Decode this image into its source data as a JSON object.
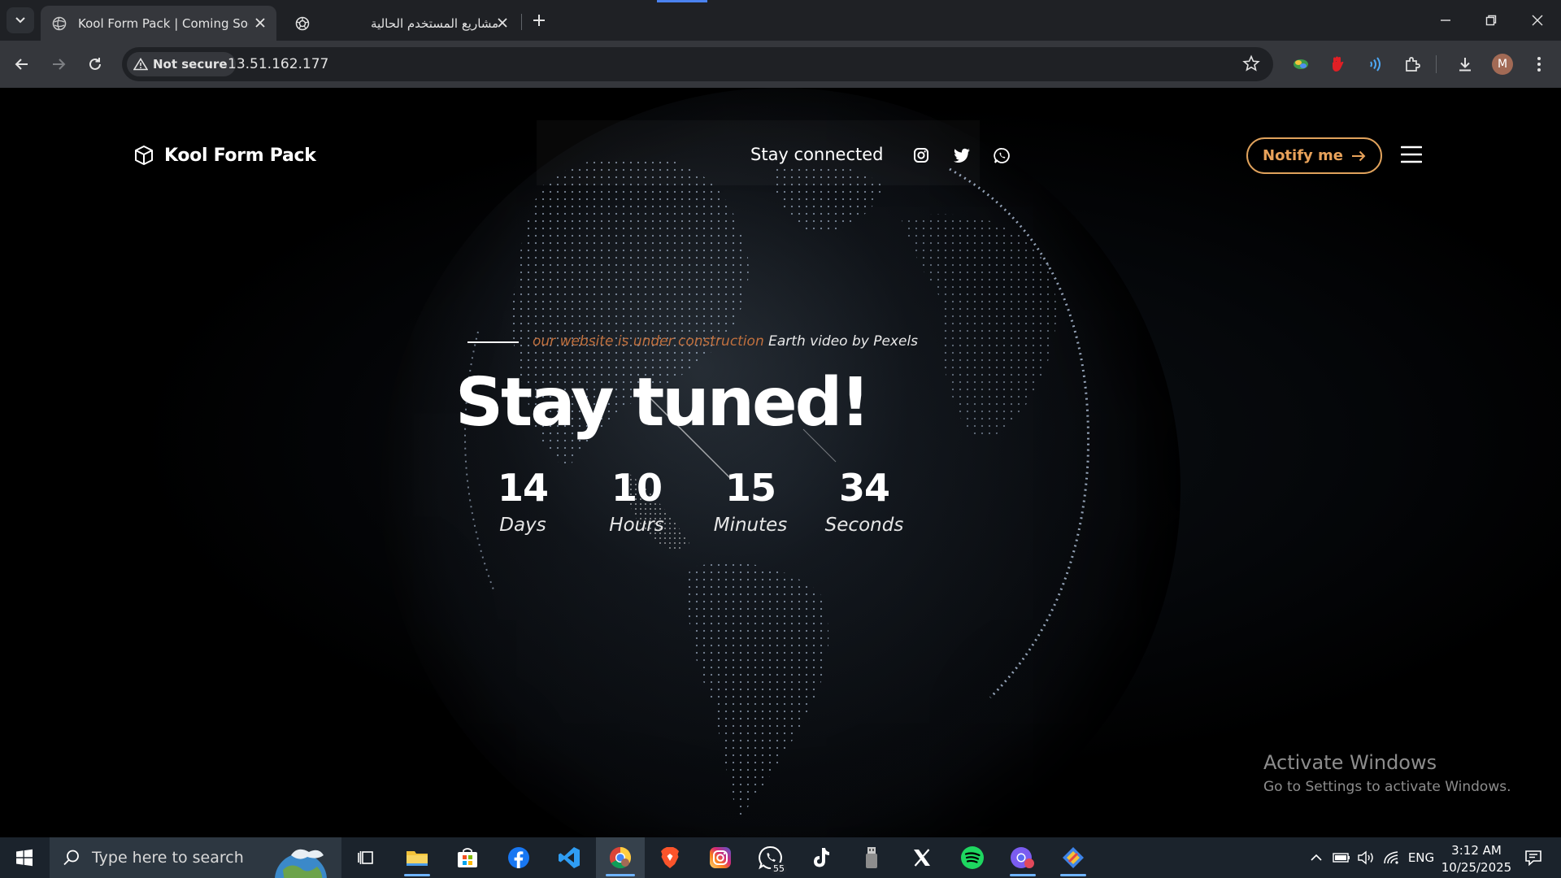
{
  "browser": {
    "tabs": [
      {
        "title": "Kool Form Pack | Coming Soon",
        "active": true
      },
      {
        "title": "مشاريع المستخدم الحالية",
        "active": false
      }
    ],
    "security_label": "Not secure",
    "url": "13.51.162.177",
    "profile_initial": "M"
  },
  "page": {
    "brand": "Kool Form Pack",
    "nav": {
      "stay_connected": "Stay connected",
      "notify_label": "Notify me"
    },
    "kicker_orange": "our website is under construction",
    "kicker_white": "Earth video by Pexels",
    "headline": "Stay tuned!",
    "countdown": [
      {
        "value": "14",
        "label": "Days"
      },
      {
        "value": "10",
        "label": "Hours"
      },
      {
        "value": "15",
        "label": "Minutes"
      },
      {
        "value": "34",
        "label": "Seconds"
      }
    ],
    "accent_color": "#e0a25c"
  },
  "watermark": {
    "title": "Activate Windows",
    "subtitle": "Go to Settings to activate Windows."
  },
  "taskbar": {
    "search_placeholder": "Type here to search",
    "whatsapp_badge": "55",
    "language": "ENG",
    "time": "3:12 AM",
    "date": "10/25/2025"
  }
}
